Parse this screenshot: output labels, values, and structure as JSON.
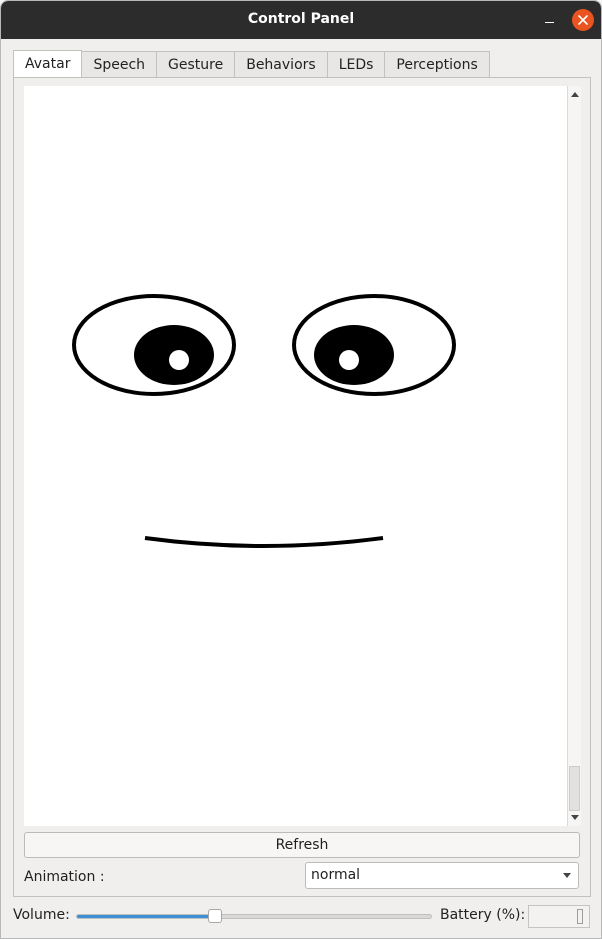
{
  "window": {
    "title": "Control Panel"
  },
  "tabs": [
    {
      "label": "Avatar",
      "active": true
    },
    {
      "label": "Speech"
    },
    {
      "label": "Gesture"
    },
    {
      "label": "Behaviors"
    },
    {
      "label": "LEDs"
    },
    {
      "label": "Perceptions"
    }
  ],
  "avatar": {
    "refresh_label": "Refresh",
    "animation_label": "Animation :",
    "animation_value": "normal"
  },
  "footer": {
    "volume_label": "Volume:",
    "volume_level": 0.39,
    "battery_label": "Battery (%):",
    "battery_value": ""
  },
  "colors": {
    "accent": "#3a8fd6",
    "close": "#e95420",
    "titlebar": "#2c2c2c"
  }
}
